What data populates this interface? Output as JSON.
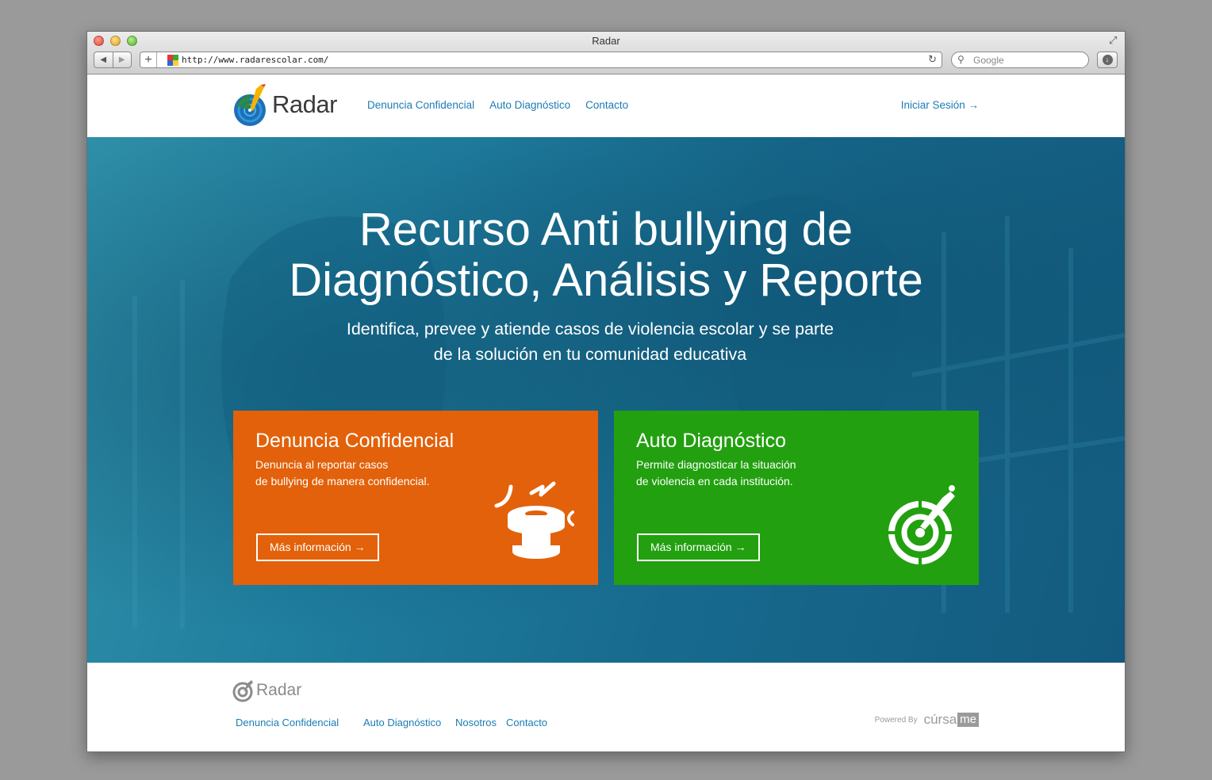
{
  "browser": {
    "window_title": "Radar",
    "url": "http://www.radarescolar.com/",
    "search_placeholder": "Google"
  },
  "header": {
    "logo_text": "Radar",
    "nav": [
      "Denuncia Confidencial",
      "Auto Diagnóstico",
      "Contacto"
    ],
    "login": "Iniciar Sesión →"
  },
  "hero": {
    "title_line1": "Recurso Anti bullying de",
    "title_line2": "Diagnóstico, Análisis y Reporte",
    "subtitle_line1": "Identifica, prevee y atiende casos de violencia escolar y se parte",
    "subtitle_line2": "de la solución en tu comunidad educativa"
  },
  "cards": [
    {
      "title": "Denuncia Confidencial",
      "desc_line1": "Denuncia al reportar casos",
      "desc_line2": "de bullying de manera confidencial.",
      "button": "Más información →",
      "color": "#e2610a",
      "icon": "alarm-bell-icon"
    },
    {
      "title": "Auto Diagnóstico",
      "desc_line1": "Permite diagnosticar la situación",
      "desc_line2": "de violencia en cada institución.",
      "button": "Más información →",
      "color": "#22a00f",
      "icon": "radar-target-icon"
    }
  ],
  "footer": {
    "logo_text": "Radar",
    "nav": [
      "Denuncia Confidencial",
      "Auto Diagnóstico",
      "Nosotros",
      "Contacto"
    ],
    "powered_by": "Powered By",
    "brand_cursa": "cúrsa",
    "brand_me": "me"
  },
  "colors": {
    "link": "#1b7cb3",
    "orange": "#e2610a",
    "green": "#22a00f",
    "hero": "#176a8e"
  }
}
